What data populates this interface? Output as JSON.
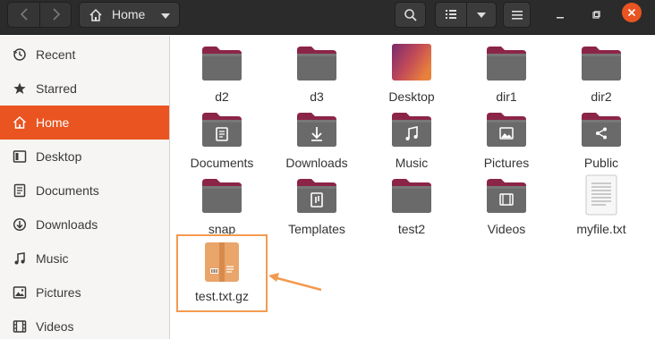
{
  "window": {
    "path_label": "Home",
    "accent": "#e95420",
    "icons": [
      "back-icon",
      "forward-icon",
      "home-icon",
      "search-icon",
      "list-view-icon",
      "menu-icon",
      "minimize-icon",
      "maximize-icon",
      "close-icon"
    ]
  },
  "sidebar": {
    "items": [
      {
        "label": "Recent",
        "icon": "clock-icon",
        "active": false
      },
      {
        "label": "Starred",
        "icon": "star-icon",
        "active": false
      },
      {
        "label": "Home",
        "icon": "home-icon",
        "active": true
      },
      {
        "label": "Desktop",
        "icon": "desktop-icon",
        "active": false
      },
      {
        "label": "Documents",
        "icon": "document-icon",
        "active": false
      },
      {
        "label": "Downloads",
        "icon": "download-icon",
        "active": false
      },
      {
        "label": "Music",
        "icon": "music-icon",
        "active": false
      },
      {
        "label": "Pictures",
        "icon": "pictures-icon",
        "active": false
      },
      {
        "label": "Videos",
        "icon": "video-icon",
        "active": false
      }
    ]
  },
  "files": [
    {
      "name": "d2",
      "kind": "folder"
    },
    {
      "name": "d3",
      "kind": "folder"
    },
    {
      "name": "Desktop",
      "kind": "desktop-folder"
    },
    {
      "name": "dir1",
      "kind": "folder"
    },
    {
      "name": "dir2",
      "kind": "folder"
    },
    {
      "name": "Documents",
      "kind": "folder-documents"
    },
    {
      "name": "Downloads",
      "kind": "folder-downloads"
    },
    {
      "name": "Music",
      "kind": "folder-music"
    },
    {
      "name": "Pictures",
      "kind": "folder-pictures"
    },
    {
      "name": "Public",
      "kind": "folder-public"
    },
    {
      "name": "snap",
      "kind": "folder"
    },
    {
      "name": "Templates",
      "kind": "folder-templates"
    },
    {
      "name": "test2",
      "kind": "folder"
    },
    {
      "name": "Videos",
      "kind": "folder-videos"
    },
    {
      "name": "myfile.txt",
      "kind": "text-file"
    },
    {
      "name": "test.txt.gz",
      "kind": "archive"
    }
  ],
  "annotation": {
    "color": "#f39a4f"
  }
}
